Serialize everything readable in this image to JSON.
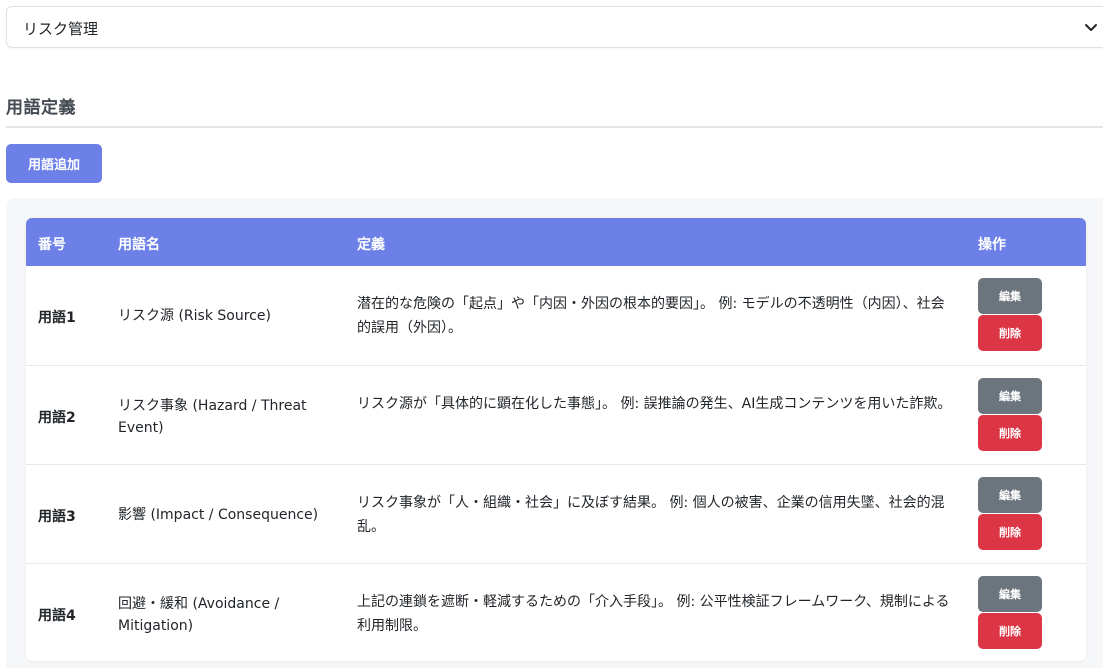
{
  "select": {
    "value": "リスク管理"
  },
  "section": {
    "title": "用語定義",
    "add_button": "用語追加"
  },
  "table": {
    "headers": {
      "num": "番号",
      "name": "用語名",
      "definition": "定義",
      "actions": "操作"
    },
    "edit_label": "編集",
    "delete_label": "削除",
    "rows": [
      {
        "num": "用語1",
        "name": "リスク源 (Risk Source)",
        "definition": "潜在的な危険の「起点」や「内因・外因の根本的要因」。 例: モデルの不透明性（内因）、社会的誤用（外因）。"
      },
      {
        "num": "用語2",
        "name": "リスク事象 (Hazard / Threat Event)",
        "definition": "リスク源が「具体的に顕在化した事態」。 例: 誤推論の発生、AI生成コンテンツを用いた詐欺。"
      },
      {
        "num": "用語3",
        "name": "影響 (Impact / Consequence)",
        "definition": "リスク事象が「人・組織・社会」に及ぼす結果。 例: 個人の被害、企業の信用失墜、社会的混乱。"
      },
      {
        "num": "用語4",
        "name": "回避・緩和 (Avoidance / Mitigation)",
        "definition": "上記の連鎖を遮断・軽減するための「介入手段」。 例: 公平性検証フレームワーク、規制による利用制限。"
      }
    ]
  },
  "colors": {
    "accent": "#6c80e8",
    "edit": "#6c757d",
    "delete": "#dc3545"
  }
}
